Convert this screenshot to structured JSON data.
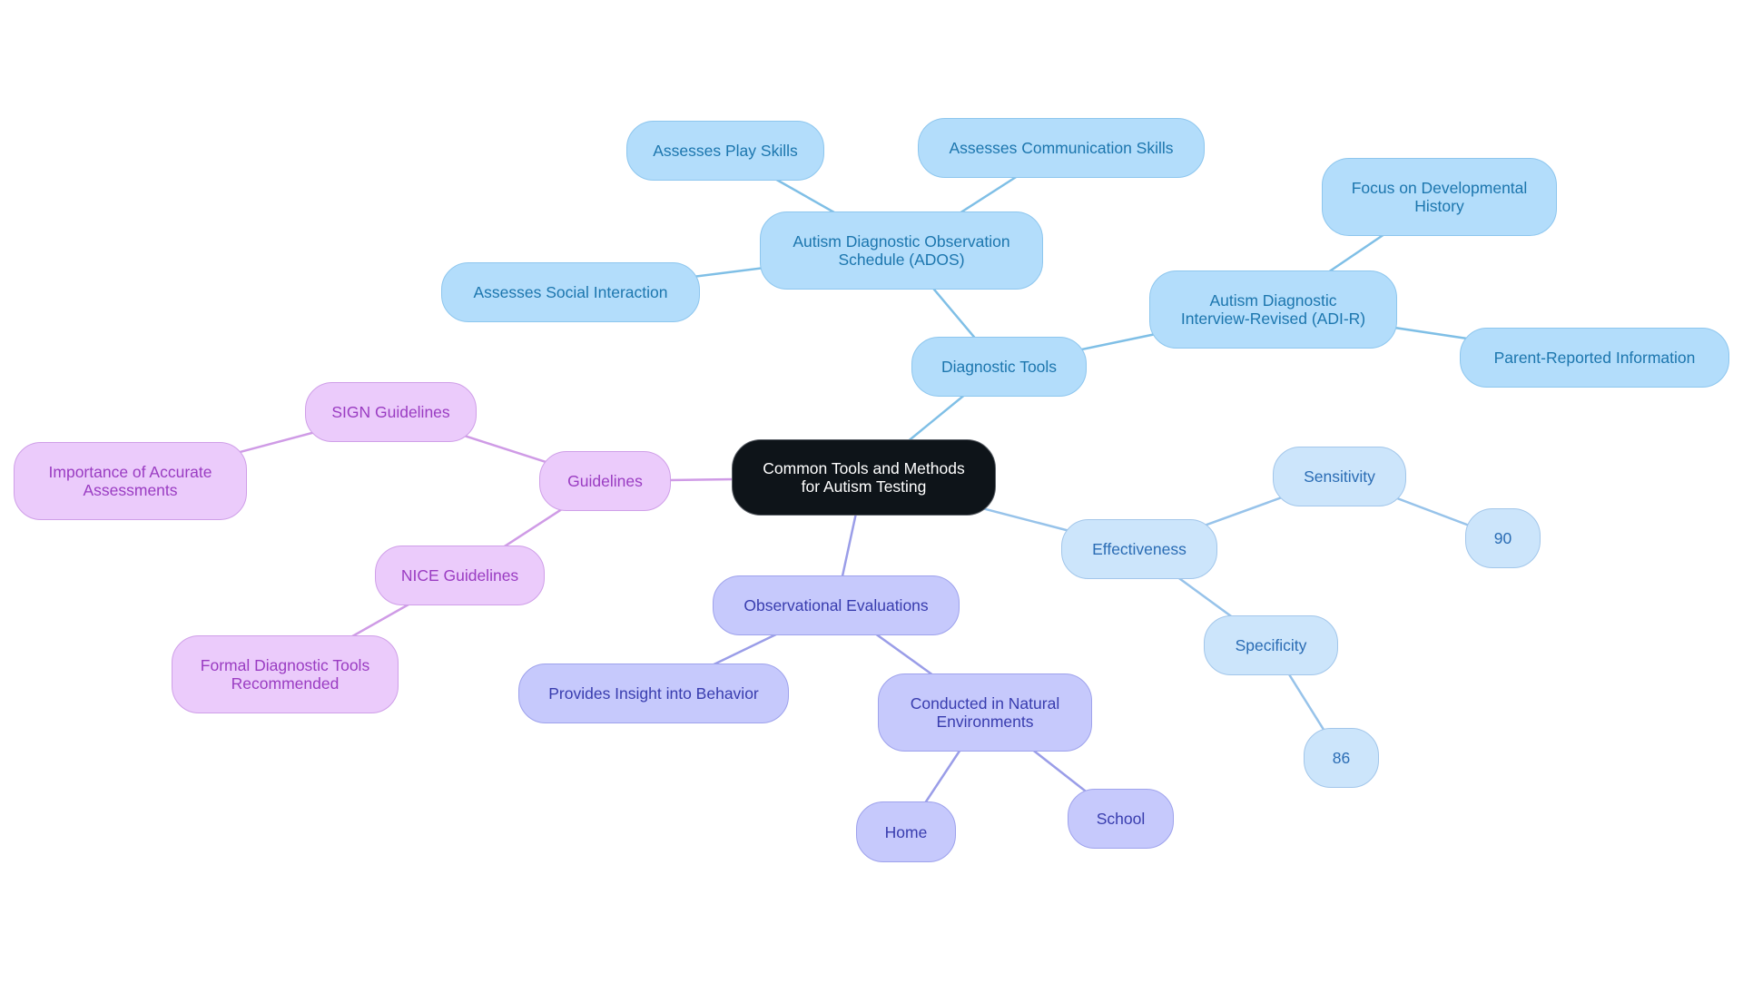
{
  "diagram": {
    "title": "Common Tools and Methods for Autism Testing",
    "branch_colors": {
      "root": {
        "fill": "#0e1419",
        "border": "#5a5f66",
        "text": "#ffffff",
        "edge": "#7fbfe6"
      },
      "diag": {
        "fill": "#b3ddfb",
        "border": "#8dc6ee",
        "text": "#1c76ae",
        "edge": "#7fbfe6"
      },
      "eff": {
        "fill": "#cce5fb",
        "border": "#a2c6ea",
        "text": "#2a6cb4",
        "edge": "#97c3ea"
      },
      "obs": {
        "fill": "#c6c9fc",
        "border": "#9ea2ec",
        "text": "#383cae",
        "edge": "#9a9de8"
      },
      "guide": {
        "fill": "#ebcbfb",
        "border": "#cf9fe8",
        "text": "#9a3cc2",
        "edge": "#cf9be6"
      }
    },
    "nodes": {
      "root": {
        "label": "Common Tools and Methods\nfor Autism Testing",
        "branch": "root"
      },
      "diagnostic_tools": {
        "label": "Diagnostic Tools",
        "branch": "diag"
      },
      "ados": {
        "label": "Autism Diagnostic Observation\nSchedule (ADOS)",
        "branch": "diag"
      },
      "play_skills": {
        "label": "Assesses Play Skills",
        "branch": "diag"
      },
      "communication_skills": {
        "label": "Assesses Communication Skills",
        "branch": "diag"
      },
      "social_interaction": {
        "label": "Assesses Social Interaction",
        "branch": "diag"
      },
      "adi_r": {
        "label": "Autism Diagnostic\nInterview-Revised (ADI-R)",
        "branch": "diag"
      },
      "developmental_history": {
        "label": "Focus on Developmental\nHistory",
        "branch": "diag"
      },
      "parent_reported": {
        "label": "Parent-Reported Information",
        "branch": "diag"
      },
      "effectiveness": {
        "label": "Effectiveness",
        "branch": "eff"
      },
      "sensitivity": {
        "label": "Sensitivity",
        "branch": "eff"
      },
      "sensitivity_value": {
        "label": "90",
        "branch": "eff"
      },
      "specificity": {
        "label": "Specificity",
        "branch": "eff"
      },
      "specificity_value": {
        "label": "86",
        "branch": "eff"
      },
      "observational": {
        "label": "Observational Evaluations",
        "branch": "obs"
      },
      "insight_behavior": {
        "label": "Provides Insight into Behavior",
        "branch": "obs"
      },
      "natural_environments": {
        "label": "Conducted in Natural\nEnvironments",
        "branch": "obs"
      },
      "home": {
        "label": "Home",
        "branch": "obs"
      },
      "school": {
        "label": "School",
        "branch": "obs"
      },
      "guidelines": {
        "label": "Guidelines",
        "branch": "guide"
      },
      "sign_guidelines": {
        "label": "SIGN Guidelines",
        "branch": "guide"
      },
      "accurate_assessments": {
        "label": "Importance of Accurate\nAssessments",
        "branch": "guide"
      },
      "nice_guidelines": {
        "label": "NICE Guidelines",
        "branch": "guide"
      },
      "formal_tools": {
        "label": "Formal Diagnostic Tools\nRecommended",
        "branch": "guide"
      }
    },
    "edges": [
      {
        "from": "root",
        "to": "diagnostic_tools",
        "branch": "diag"
      },
      {
        "from": "diagnostic_tools",
        "to": "ados",
        "branch": "diag"
      },
      {
        "from": "ados",
        "to": "play_skills",
        "branch": "diag"
      },
      {
        "from": "ados",
        "to": "communication_skills",
        "branch": "diag"
      },
      {
        "from": "ados",
        "to": "social_interaction",
        "branch": "diag"
      },
      {
        "from": "diagnostic_tools",
        "to": "adi_r",
        "branch": "diag"
      },
      {
        "from": "adi_r",
        "to": "developmental_history",
        "branch": "diag"
      },
      {
        "from": "adi_r",
        "to": "parent_reported",
        "branch": "diag"
      },
      {
        "from": "root",
        "to": "effectiveness",
        "branch": "eff"
      },
      {
        "from": "effectiveness",
        "to": "sensitivity",
        "branch": "eff"
      },
      {
        "from": "sensitivity",
        "to": "sensitivity_value",
        "branch": "eff"
      },
      {
        "from": "effectiveness",
        "to": "specificity",
        "branch": "eff"
      },
      {
        "from": "specificity",
        "to": "specificity_value",
        "branch": "eff"
      },
      {
        "from": "root",
        "to": "observational",
        "branch": "obs"
      },
      {
        "from": "observational",
        "to": "insight_behavior",
        "branch": "obs"
      },
      {
        "from": "observational",
        "to": "natural_environments",
        "branch": "obs"
      },
      {
        "from": "natural_environments",
        "to": "home",
        "branch": "obs"
      },
      {
        "from": "natural_environments",
        "to": "school",
        "branch": "obs"
      },
      {
        "from": "root",
        "to": "guidelines",
        "branch": "guide"
      },
      {
        "from": "guidelines",
        "to": "sign_guidelines",
        "branch": "guide"
      },
      {
        "from": "sign_guidelines",
        "to": "accurate_assessments",
        "branch": "guide"
      },
      {
        "from": "guidelines",
        "to": "nice_guidelines",
        "branch": "guide"
      },
      {
        "from": "nice_guidelines",
        "to": "formal_tools",
        "branch": "guide"
      }
    ]
  }
}
